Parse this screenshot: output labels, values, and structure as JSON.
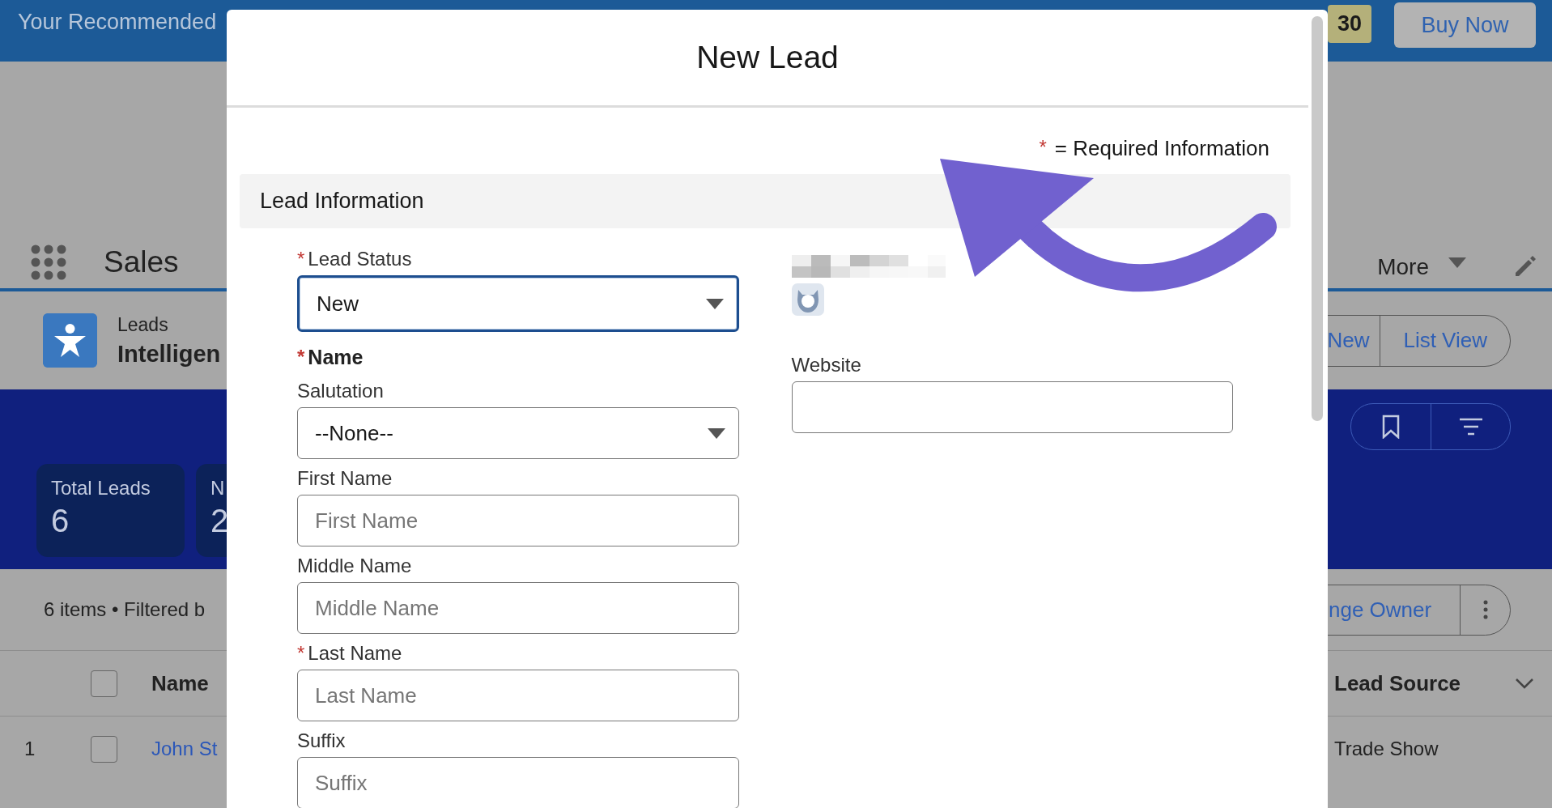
{
  "top_bar": {
    "title": "Your Recommended",
    "badge": "30",
    "buy_button": "Buy Now"
  },
  "nav": {
    "app_name": "Sales",
    "more": "More"
  },
  "object_header": {
    "object": "Leads",
    "list_name": "Intelligen",
    "buttons": [
      "New",
      "List View"
    ]
  },
  "stat_cards": [
    {
      "label": "Total Leads",
      "value": "6"
    },
    {
      "label": "N",
      "value": "2"
    }
  ],
  "list_info": {
    "summary": "6 items • Filtered b",
    "action": "nge Owner"
  },
  "table": {
    "select_all_checked": false,
    "columns": [
      "Name",
      "Lead Source"
    ],
    "rows": [
      {
        "number": "1",
        "checked": false,
        "name": "John St",
        "lead_source": "Trade Show"
      }
    ]
  },
  "modal": {
    "title": "New Lead",
    "required_mark": "*",
    "required_note": "= Required Information",
    "section": "Lead Information",
    "left_fields": [
      {
        "kind": "select",
        "label": "Lead Status",
        "required_mark": "*",
        "value": "New",
        "focused": true
      },
      {
        "kind": "heading",
        "label": "Name",
        "required_mark": "*"
      },
      {
        "kind": "select",
        "label": "Salutation",
        "value": "--None--",
        "focused": false
      },
      {
        "kind": "input",
        "label": "First Name",
        "placeholder": "First Name"
      },
      {
        "kind": "input",
        "label": "Middle Name",
        "placeholder": "Middle Name"
      },
      {
        "kind": "input",
        "label": "Last Name",
        "required_mark": "*",
        "placeholder": "Last Name"
      },
      {
        "kind": "input",
        "label": "Suffix",
        "placeholder": "Suffix"
      }
    ],
    "right_fields": [
      {
        "kind": "owner"
      },
      {
        "kind": "input",
        "label": "Website"
      }
    ]
  }
}
